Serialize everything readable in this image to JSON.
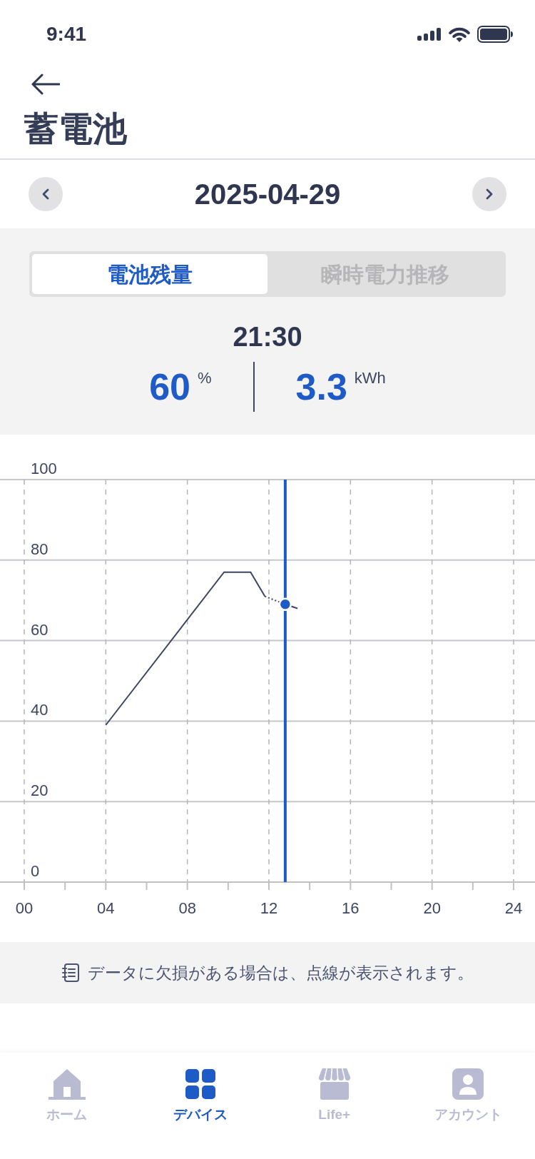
{
  "status_bar": {
    "time": "9:41"
  },
  "header": {
    "title": "蓄電池"
  },
  "date_nav": {
    "date": "2025-04-29"
  },
  "tabs": [
    {
      "label": "電池残量",
      "selected": true
    },
    {
      "label": "瞬時電力推移",
      "selected": false
    }
  ],
  "readout": {
    "time": "21:30",
    "items": [
      {
        "value": "60",
        "unit": "%"
      },
      {
        "value": "3.3",
        "unit": "kWh"
      }
    ]
  },
  "chart": {
    "chart_data": {
      "type": "line",
      "x": [
        4,
        9.8,
        11.1,
        11.8,
        12.3,
        12.8,
        13.4
      ],
      "series": [
        {
          "color": "#3d4560",
          "values": [
            39,
            77,
            77,
            71,
            null,
            69,
            68
          ]
        }
      ],
      "xlim": [
        0,
        24
      ],
      "ylim": [
        0,
        100
      ],
      "xticks": [
        {
          "value": 0,
          "label": "00"
        },
        {
          "value": 4,
          "label": "04"
        },
        {
          "value": 8,
          "label": "08"
        },
        {
          "value": 12,
          "label": "12"
        },
        {
          "value": 16,
          "label": "16"
        },
        {
          "value": 20,
          "label": "20"
        },
        {
          "value": 24,
          "label": "24"
        }
      ],
      "yticks": [
        0,
        20,
        40,
        60,
        80,
        100
      ],
      "grid": true,
      "ref_lines": [
        {
          "axis": "x",
          "value": 12.8,
          "color": "#1f5bc6"
        }
      ]
    }
  },
  "note": {
    "text": "データに欠損がある場合は、点線が表示されます。"
  },
  "bottom_nav": [
    {
      "label": "ホーム",
      "selected": false
    },
    {
      "label": "デバイス",
      "selected": true
    },
    {
      "label": "Life+",
      "selected": false
    },
    {
      "label": "アカウント",
      "selected": false
    }
  ]
}
